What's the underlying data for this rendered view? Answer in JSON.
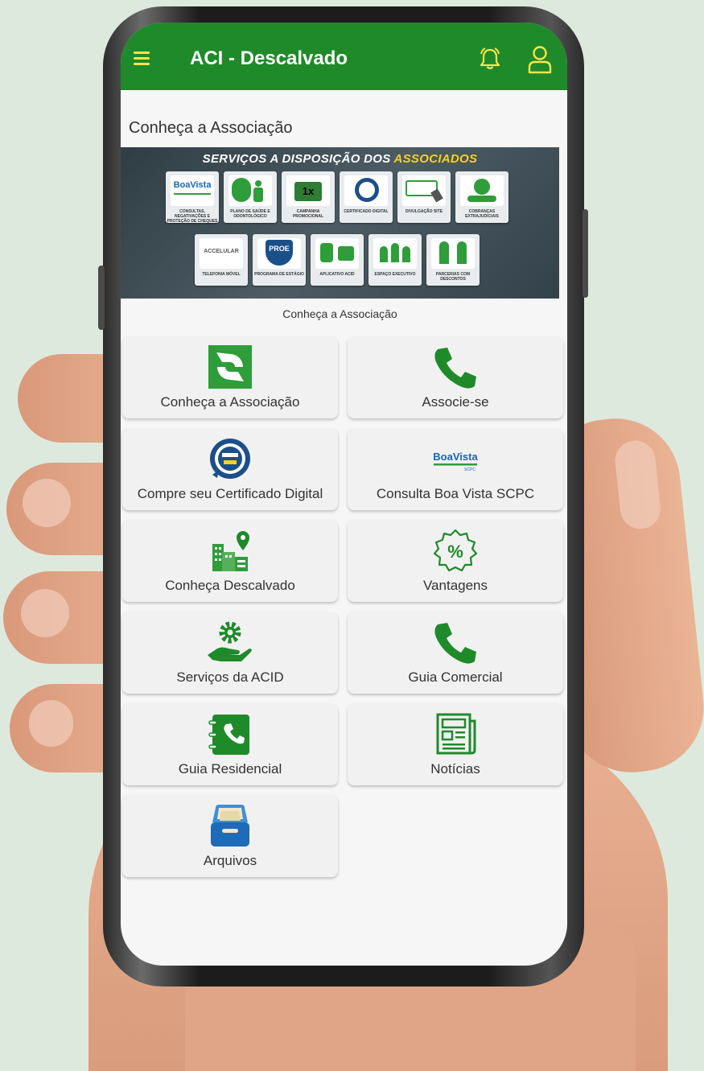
{
  "header": {
    "title": "ACI - Descalvado",
    "color": "#1f8a2a",
    "icon_color": "#fbe54a",
    "icons": [
      "menu-icon",
      "bell-icon",
      "user-icon"
    ]
  },
  "section_title": "Conheça a Associação",
  "banner": {
    "title_part1": "SERVIÇOS A DISPOSIÇÃO DOS ",
    "title_highlight": "ASSOCIADOS",
    "caption": "Conheça a Associação",
    "tiles": [
      {
        "label": "CONSULTAS, NEGATIVAÇÕES E PROTEÇÃO DE CHEQUES",
        "brand": "BoaVista"
      },
      {
        "label": "PLANO DE SAÚDE E ODONTOLÓGICO"
      },
      {
        "label": "CAMPANHA PROMOCIONAL"
      },
      {
        "label": "CERTIFICADO DIGITAL"
      },
      {
        "label": "DIVULGAÇÃO SITE"
      },
      {
        "label": "COBRANÇAS EXTRAJUDICIAIS"
      },
      {
        "label": "TELEFONIA MÓVEL",
        "brand": "ACCELULAR"
      },
      {
        "label": "PROGRAMA DE ESTÁGIO",
        "brand": "PROE"
      },
      {
        "label": "APLICATIVO ACID"
      },
      {
        "label": "ESPAÇO EXECUTIVO"
      },
      {
        "label": "PARCERIAS COM DESCONTOS"
      }
    ]
  },
  "menu": [
    {
      "label": "Conheça a Associação",
      "icon": "logo-icon"
    },
    {
      "label": "Associe-se",
      "icon": "phone-icon"
    },
    {
      "label": "Compre seu Certificado Digital",
      "icon": "certisign-icon"
    },
    {
      "label": "Consulta Boa Vista SCPC",
      "icon": "boavista-icon"
    },
    {
      "label": "Conheça Descalvado",
      "icon": "city-icon"
    },
    {
      "label": "Vantagens",
      "icon": "percent-icon"
    },
    {
      "label": "Serviços da ACID",
      "icon": "gear-hand-icon"
    },
    {
      "label": "Guia Comercial",
      "icon": "phone-icon"
    },
    {
      "label": "Guia Residencial",
      "icon": "phonebook-icon"
    },
    {
      "label": "Notícias",
      "icon": "newspaper-icon"
    },
    {
      "label": "Arquivos",
      "icon": "archive-icon"
    }
  ]
}
